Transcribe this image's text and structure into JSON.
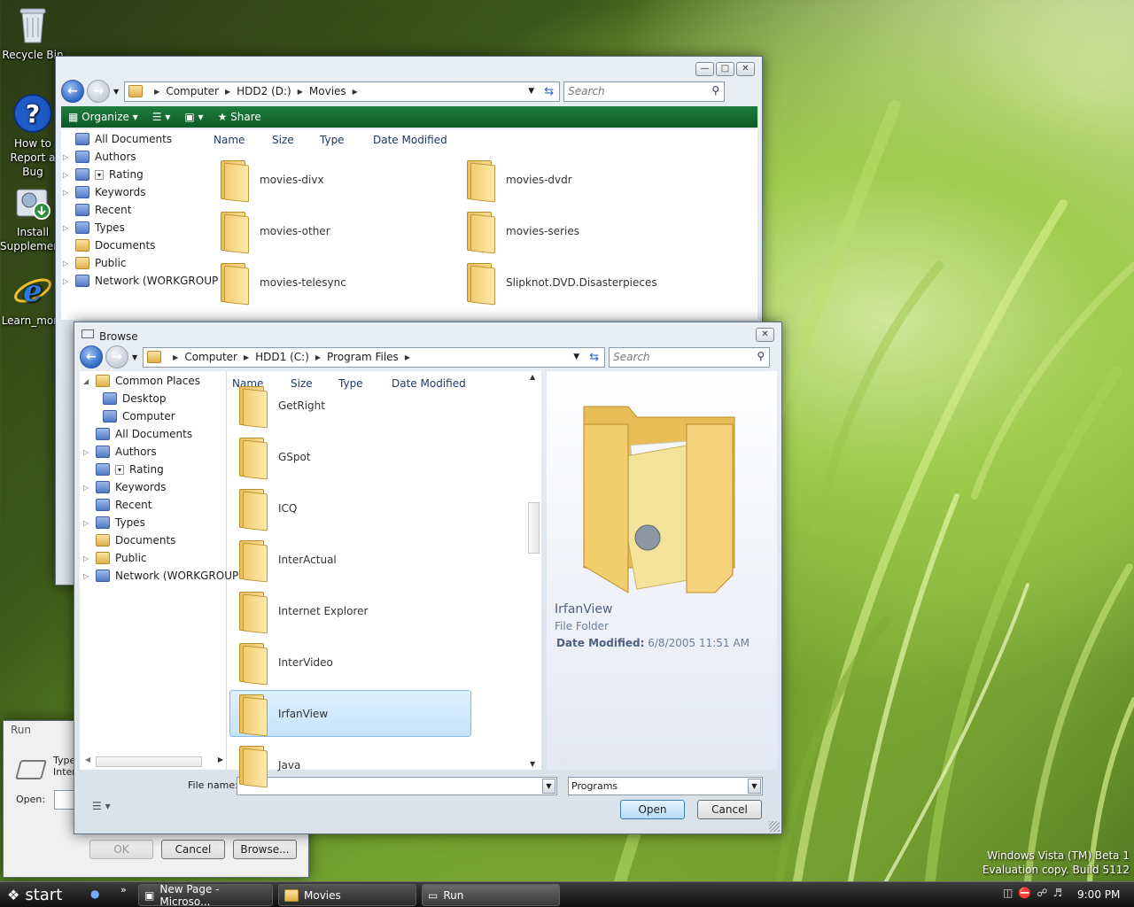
{
  "desktop": {
    "icons": [
      {
        "label": "Recycle Bin",
        "icon": "recycle-bin-icon"
      },
      {
        "label": "How to Report a Bug",
        "icon": "help-icon"
      },
      {
        "label": "Install Supplemental",
        "icon": "install-icon"
      },
      {
        "label": "Learn_more",
        "icon": "ie-icon"
      }
    ],
    "watermark_line1": "Windows Vista (TM) Beta 1",
    "watermark_line2": "Evaluation copy. Build 5112"
  },
  "explorer": {
    "breadcrumbs": [
      "Computer",
      "HDD2 (D:)",
      "Movies"
    ],
    "search_placeholder": "Search",
    "toolbar": {
      "organize": "Organize",
      "share": "Share"
    },
    "nav": [
      "All Documents",
      "Authors",
      "Rating",
      "Keywords",
      "Recent",
      "Types",
      "Documents",
      "Public",
      "Network (WORKGROUP"
    ],
    "columns": [
      "Name",
      "Size",
      "Type",
      "Date Modified"
    ],
    "folders": [
      "movies-divx",
      "movies-dvdr",
      "movies-other",
      "movies-series",
      "movies-telesync",
      "Slipknot.DVD.Disasterpieces"
    ]
  },
  "browse": {
    "title": "Browse",
    "breadcrumbs": [
      "Computer",
      "HDD1 (C:)",
      "Program Files"
    ],
    "search_placeholder": "Search",
    "nav": [
      "Common Places",
      "Desktop",
      "Computer",
      "All Documents",
      "Authors",
      "Rating",
      "Keywords",
      "Recent",
      "Types",
      "Documents",
      "Public",
      "Network (WORKGROUP"
    ],
    "columns": [
      "Name",
      "Size",
      "Type",
      "Date Modified"
    ],
    "folders": [
      "GetRight",
      "GSpot",
      "ICQ",
      "InterActual",
      "Internet Explorer",
      "InterVideo",
      "IrfanView",
      "Java"
    ],
    "selected": "IrfanView",
    "preview": {
      "name": "IrfanView",
      "type": "File Folder",
      "date_label": "Date Modified:",
      "date_value": "6/8/2005 11:51 AM"
    },
    "file_name_label": "File name:",
    "file_name_value": "",
    "filter": "Programs",
    "open": "Open",
    "cancel": "Cancel"
  },
  "run": {
    "title": "Run",
    "desc_line1": "Type",
    "desc_line2": "Inter",
    "open_label": "Open:",
    "ok": "OK",
    "cancel": "Cancel",
    "browse": "Browse..."
  },
  "taskbar": {
    "start": "start",
    "tasks": [
      "New Page - Microso...",
      "Movies",
      "Run"
    ],
    "clock": "9:00 PM"
  }
}
